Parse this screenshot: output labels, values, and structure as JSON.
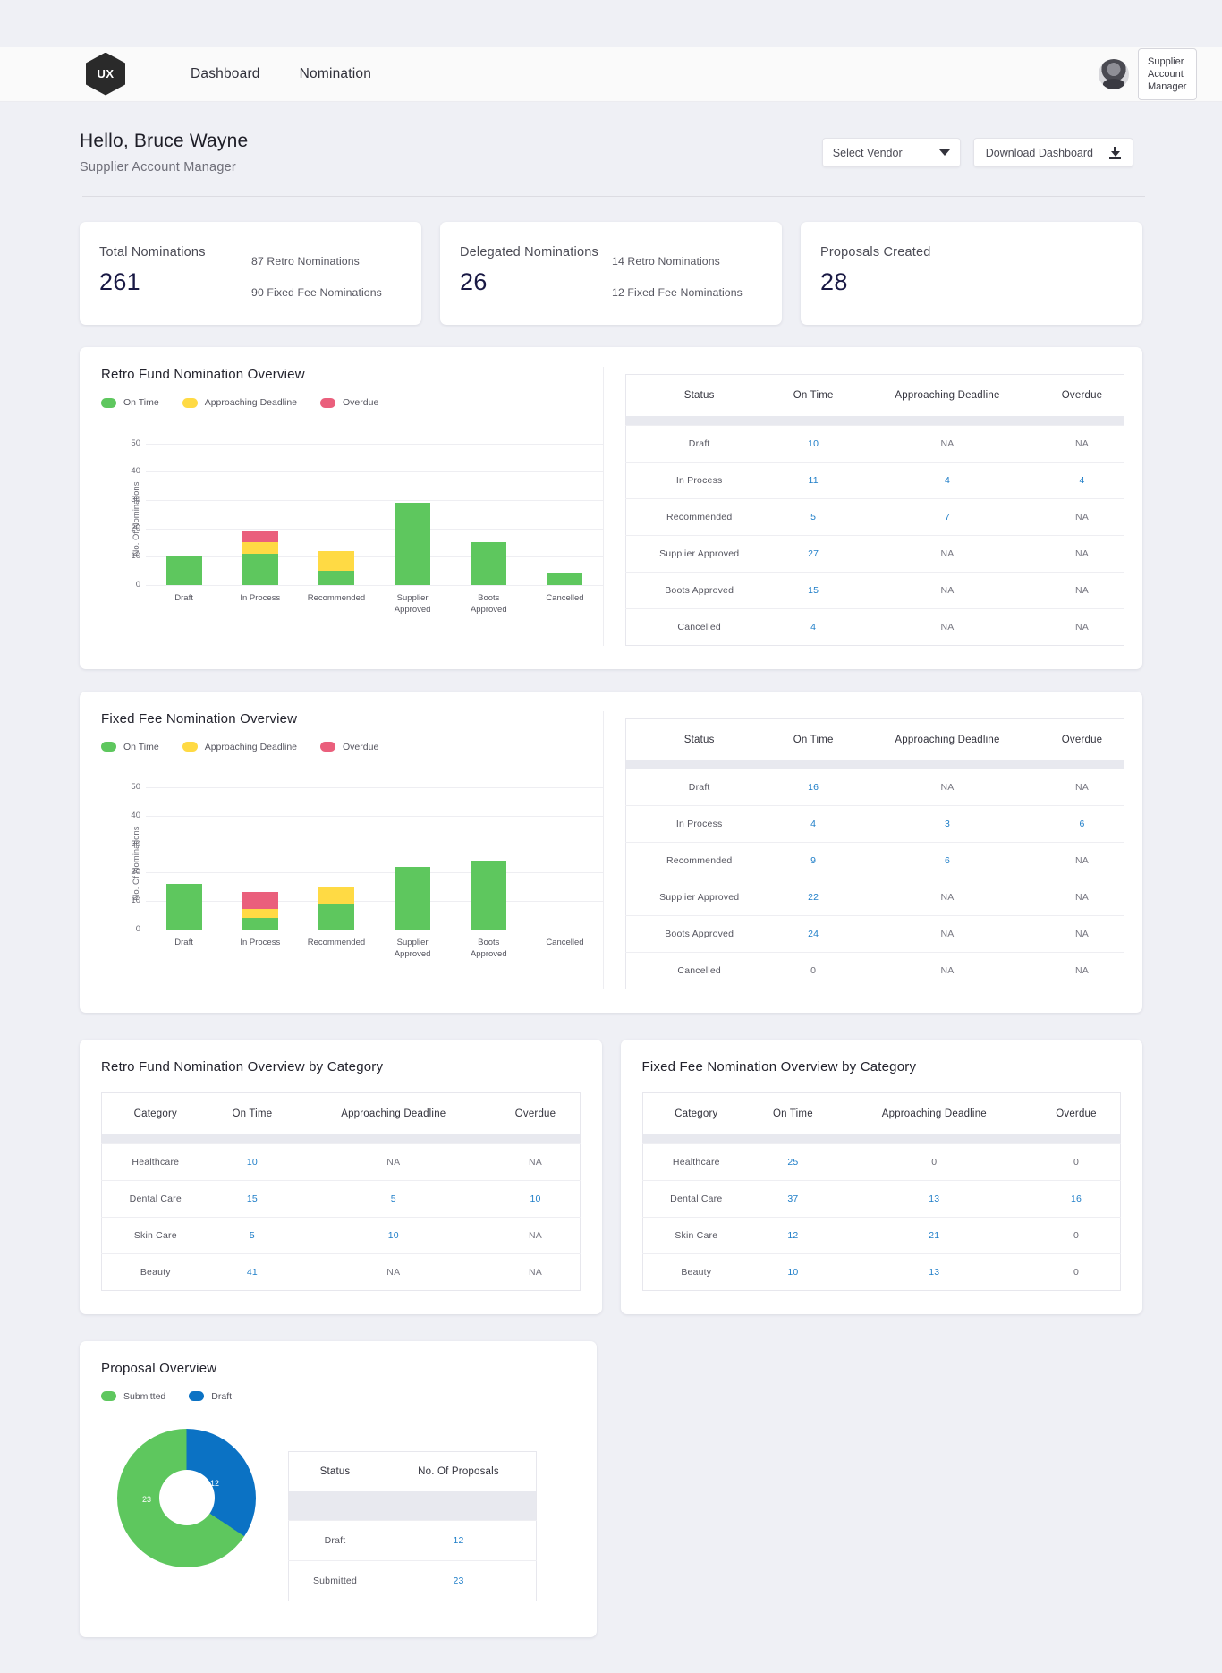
{
  "nav": {
    "logo_text": "UX",
    "links": [
      "Dashboard",
      "Nomination"
    ],
    "role_badge": "Supplier Account Manager"
  },
  "greeting": {
    "hello": "Hello, Bruce Wayne",
    "role": "Supplier Account Manager",
    "vendor_select": "Select Vendor",
    "download_label": "Download Dashboard"
  },
  "stats": [
    {
      "title": "Total Nominations",
      "value": "261",
      "lines": [
        "87 Retro Nominations",
        "90 Fixed Fee Nominations"
      ]
    },
    {
      "title": "Delegated Nominations",
      "value": "26",
      "lines": [
        "14 Retro Nominations",
        "12 Fixed Fee Nominations"
      ]
    },
    {
      "title": "Proposals Created",
      "value": "28",
      "lines": []
    }
  ],
  "legend": [
    {
      "label": "On Time",
      "color": "#5ec75e"
    },
    {
      "label": "Approaching Deadline",
      "color": "#ffda44"
    },
    {
      "label": "Overdue",
      "color": "#ea5f7c"
    }
  ],
  "retro": {
    "title": "Retro Fund Nomination Overview",
    "table": {
      "headers": [
        "Status",
        "On Time",
        "Approaching Deadline",
        "Overdue"
      ],
      "rows": [
        [
          "Draft",
          "10",
          "NA",
          "NA"
        ],
        [
          "In Process",
          "11",
          "4",
          "4"
        ],
        [
          "Recommended",
          "5",
          "7",
          "NA"
        ],
        [
          "Supplier Approved",
          "27",
          "NA",
          "NA"
        ],
        [
          "Boots Approved",
          "15",
          "NA",
          "NA"
        ],
        [
          "Cancelled",
          "4",
          "NA",
          "NA"
        ]
      ]
    }
  },
  "fixed": {
    "title": "Fixed Fee Nomination Overview",
    "table": {
      "headers": [
        "Status",
        "On Time",
        "Approaching Deadline",
        "Overdue"
      ],
      "rows": [
        [
          "Draft",
          "16",
          "NA",
          "NA"
        ],
        [
          "In Process",
          "4",
          "3",
          "6"
        ],
        [
          "Recommended",
          "9",
          "6",
          "NA"
        ],
        [
          "Supplier Approved",
          "22",
          "NA",
          "NA"
        ],
        [
          "Boots Approved",
          "24",
          "NA",
          "NA"
        ],
        [
          "Cancelled",
          "0",
          "NA",
          "NA"
        ]
      ]
    }
  },
  "retro_category": {
    "title": "Retro Fund Nomination Overview by Category",
    "headers": [
      "Category",
      "On Time",
      "Approaching Deadline",
      "Overdue"
    ],
    "rows": [
      [
        "Healthcare",
        "10",
        "NA",
        "NA"
      ],
      [
        "Dental Care",
        "15",
        "5",
        "10"
      ],
      [
        "Skin Care",
        "5",
        "10",
        "NA"
      ],
      [
        "Beauty",
        "41",
        "NA",
        "NA"
      ]
    ]
  },
  "fixed_category": {
    "title": "Fixed Fee Nomination Overview by Category",
    "headers": [
      "Category",
      "On Time",
      "Approaching Deadline",
      "Overdue"
    ],
    "rows": [
      [
        "Healthcare",
        "25",
        "0",
        "0"
      ],
      [
        "Dental Care",
        "37",
        "13",
        "16"
      ],
      [
        "Skin Care",
        "12",
        "21",
        "0"
      ],
      [
        "Beauty",
        "10",
        "13",
        "0"
      ]
    ]
  },
  "proposal": {
    "title": "Proposal Overview",
    "legend": [
      {
        "label": "Submitted",
        "color": "#5ec75e"
      },
      {
        "label": "Draft",
        "color": "#0b72c4"
      }
    ],
    "slice_labels": {
      "draft": "12",
      "submitted": "23"
    },
    "table": {
      "headers": [
        "Status",
        "No. Of Proposals"
      ],
      "rows": [
        [
          "Draft",
          "12"
        ],
        [
          "Submitted",
          "23"
        ]
      ]
    }
  },
  "chart_data": [
    {
      "type": "bar",
      "title": "Retro Fund Nomination Overview",
      "stacked": true,
      "xlabel": "",
      "ylabel": "No. Of Nominations",
      "ylim": [
        0,
        55
      ],
      "yticks": [
        0,
        10,
        20,
        30,
        40,
        50
      ],
      "grid": true,
      "legend_position": "top-left",
      "categories": [
        "Draft",
        "In Process",
        "Recommended",
        "Supplier Approved",
        "Boots Approved",
        "Cancelled"
      ],
      "series": [
        {
          "name": "On Time",
          "color": "#5ec75e",
          "values": [
            10,
            11,
            5,
            29,
            15,
            4
          ]
        },
        {
          "name": "Approaching Deadline",
          "color": "#ffda44",
          "values": [
            0,
            4,
            7,
            0,
            0,
            0
          ]
        },
        {
          "name": "Overdue",
          "color": "#ea5f7c",
          "values": [
            0,
            4,
            0,
            0,
            0,
            0
          ]
        }
      ]
    },
    {
      "type": "bar",
      "title": "Fixed Fee Nomination Overview",
      "stacked": true,
      "xlabel": "",
      "ylabel": "No. Of Nominations",
      "ylim": [
        0,
        55
      ],
      "yticks": [
        0,
        10,
        20,
        30,
        40,
        50
      ],
      "grid": true,
      "legend_position": "top-left",
      "categories": [
        "Draft",
        "In Process",
        "Recommended",
        "Supplier Approved",
        "Boots Approved",
        "Cancelled"
      ],
      "series": [
        {
          "name": "On Time",
          "color": "#5ec75e",
          "values": [
            16,
            4,
            9,
            22,
            24,
            0
          ]
        },
        {
          "name": "Approaching Deadline",
          "color": "#ffda44",
          "values": [
            0,
            3,
            6,
            0,
            0,
            0
          ]
        },
        {
          "name": "Overdue",
          "color": "#ea5f7c",
          "values": [
            0,
            6,
            0,
            0,
            0,
            0
          ]
        }
      ]
    },
    {
      "type": "pie",
      "title": "Proposal Overview",
      "donut": true,
      "labels": [
        "Draft",
        "Submitted"
      ],
      "values": [
        12,
        23
      ],
      "colors": [
        "#0b72c4",
        "#5ec75e"
      ],
      "legend_position": "top-left"
    }
  ]
}
